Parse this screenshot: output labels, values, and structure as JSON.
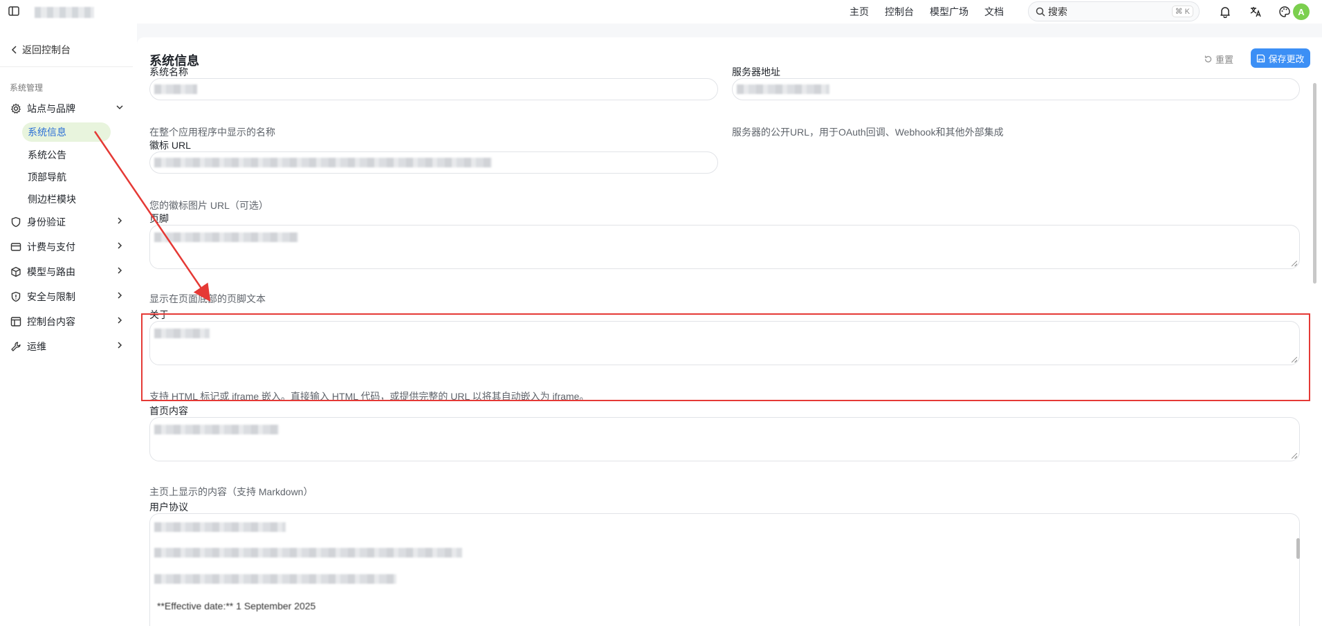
{
  "topnav": {
    "items": [
      "主页",
      "控制台",
      "模型广场",
      "文档"
    ],
    "search_placeholder": "搜索",
    "search_shortcut": "⌘ K",
    "avatar_letter": "A"
  },
  "sidebar": {
    "back_label": "返回控制台",
    "section_label": "系统管理",
    "groups": [
      {
        "label": "站点与品牌",
        "icon": "gear-icon",
        "expanded": true
      },
      {
        "label": "身份验证",
        "icon": "shield-icon"
      },
      {
        "label": "计费与支付",
        "icon": "card-icon"
      },
      {
        "label": "模型与路由",
        "icon": "cube-icon"
      },
      {
        "label": "安全与限制",
        "icon": "shield-alert-icon"
      },
      {
        "label": "控制台内容",
        "icon": "layout-icon"
      },
      {
        "label": "运维",
        "icon": "wrench-icon"
      }
    ],
    "sub_items": [
      "系统信息",
      "系统公告",
      "顶部导航",
      "侧边栏模块"
    ],
    "active_sub": "系统信息"
  },
  "page": {
    "title": "系统信息",
    "reset_label": "重置",
    "save_label": "保存更改"
  },
  "form": {
    "system_name": {
      "label": "系统名称",
      "help": "在整个应用程序中显示的名称"
    },
    "server_address": {
      "label": "服务器地址",
      "help": "服务器的公开URL，用于OAuth回调、Webhook和其他外部集成"
    },
    "logo_url": {
      "label": "徽标 URL",
      "help": "您的徽标图片 URL（可选）"
    },
    "footer": {
      "label": "页脚",
      "help": "显示在页面底部的页脚文本"
    },
    "about": {
      "label": "关于",
      "help": "支持 HTML 标记或 iframe 嵌入。直接输入 HTML 代码，或提供完整的 URL 以将其自动嵌入为 iframe。"
    },
    "home_content": {
      "label": "首页内容",
      "help": "主页上显示的内容（支持 Markdown）"
    },
    "user_agreement": {
      "label": "用户协议",
      "visible_line": "**Effective date:** 1 September 2025"
    }
  },
  "colors": {
    "accent": "#3c8ff5",
    "highlight": "#e53935",
    "active_bg": "#e8f4dd",
    "active_text": "#2b6fd6"
  }
}
